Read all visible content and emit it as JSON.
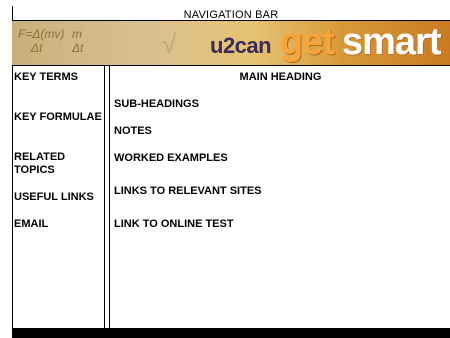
{
  "nav": {
    "title": "NAVIGATION BAR"
  },
  "banner": {
    "formula_left": "F=Δ(mv)\n    Δt",
    "formula_right": "m\nΔt",
    "brand_small": "u2can",
    "brand_get": "get",
    "brand_smart": "smart"
  },
  "sidebar": {
    "items": [
      {
        "label": "KEY TERMS"
      },
      {
        "label": "KEY FORMULAE"
      },
      {
        "label": "RELATED TOPICS"
      },
      {
        "label": "USEFUL LINKS"
      },
      {
        "label": "EMAIL"
      }
    ]
  },
  "main": {
    "heading": "MAIN HEADING",
    "items": [
      {
        "label": "SUB-HEADINGS"
      },
      {
        "label": "NOTES"
      },
      {
        "label": "WORKED EXAMPLES"
      },
      {
        "label": "LINKS TO RELEVANT SITES"
      },
      {
        "label": "LINK TO ONLINE TEST"
      }
    ]
  }
}
